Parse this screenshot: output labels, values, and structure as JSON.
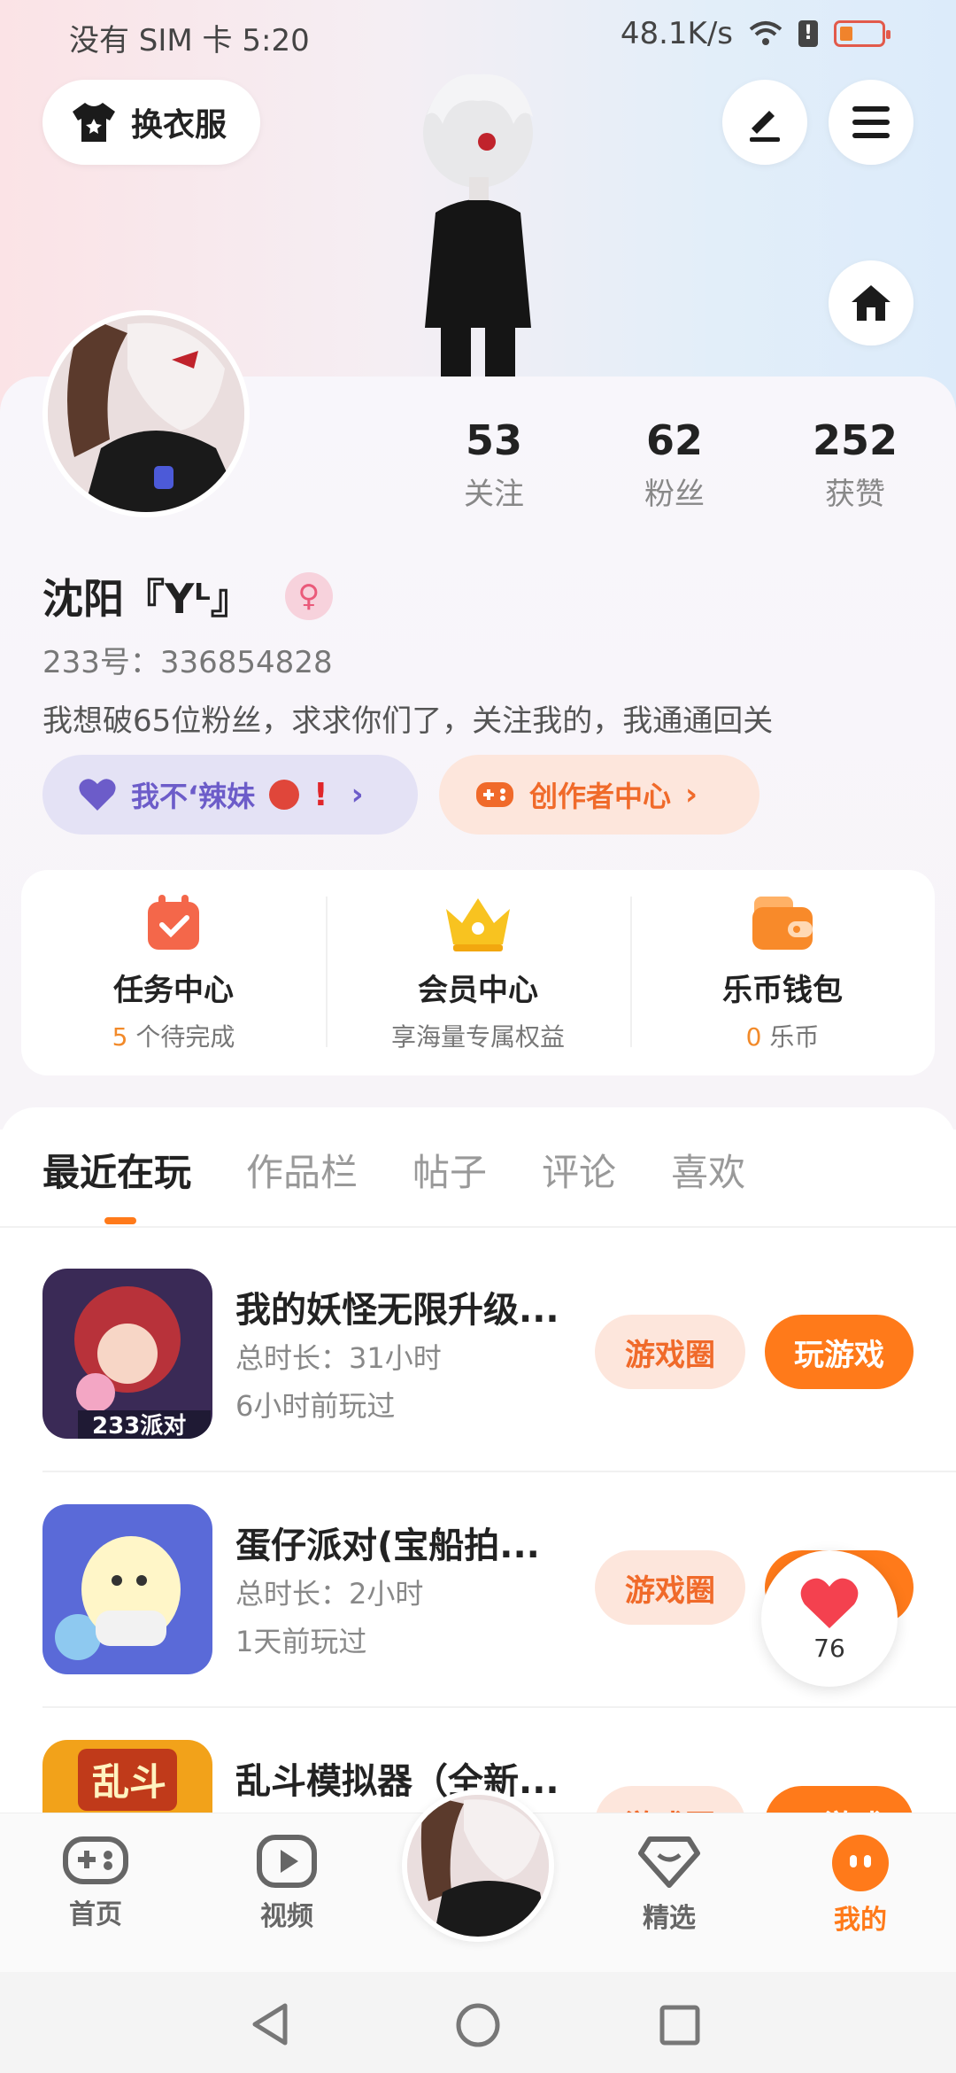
{
  "status_bar": {
    "carrier": "没有 SIM 卡",
    "time": "5:20",
    "speed": "48.1K/s"
  },
  "header": {
    "outfit_label": "换衣服"
  },
  "stats": [
    {
      "num": "53",
      "label": "关注"
    },
    {
      "num": "62",
      "label": "粉丝"
    },
    {
      "num": "252",
      "label": "获赞"
    }
  ],
  "profile": {
    "name": "沈阳『Yᴸ』",
    "uid": "233号：336854828",
    "bio": "我想破65位粉丝，求求你们了，关注我的，我通通回关"
  },
  "tags": {
    "group": "我不‘辣妹",
    "creator": "创作者中心"
  },
  "services": [
    {
      "title": "任务中心",
      "count": "5",
      "sub": " 个待完成"
    },
    {
      "title": "会员中心",
      "sub": "享海量专属权益"
    },
    {
      "title": "乐币钱包",
      "count": "0",
      "sub": " 乐币"
    }
  ],
  "tabs": [
    "最近在玩",
    "作品栏",
    "帖子",
    "评论",
    "喜欢"
  ],
  "games": [
    {
      "title": "我的妖怪无限升级...",
      "duration": "总时长：31小时",
      "last": "6小时前玩过",
      "circle": "游戏圈",
      "play": "玩游戏"
    },
    {
      "title": "蛋仔派对(宝船拍...",
      "duration": "总时长：2小时",
      "last": "1天前玩过",
      "circle": "游戏圈",
      "play": "玩游戏"
    },
    {
      "title": "乱斗模拟器（全新...",
      "duration": "",
      "last": "",
      "circle": "游戏圈",
      "play": "玩游戏"
    }
  ],
  "like_count": "76",
  "nav": [
    "首页",
    "视频",
    "精选",
    "我的"
  ],
  "colors": {
    "accent": "#ff7a1a",
    "purple": "#6c5cc9"
  }
}
